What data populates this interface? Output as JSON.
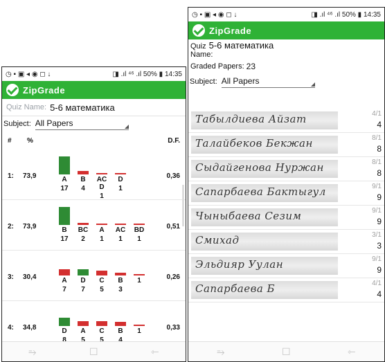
{
  "status_bar": {
    "left_icons": "◷ ▪ ▣ ◂ ◉ ◻ ↓",
    "right_text": "◨ .ıl ⁴⁶ .ıl 50% ▮ 14:35"
  },
  "app": {
    "title": "ZipGrade"
  },
  "left_phone": {
    "quiz_label": "Quiz Name:",
    "quiz_name": "5-6 математика",
    "subject_label": "Subject:",
    "subject_value": "All Papers",
    "headers": {
      "num": "#",
      "pct": "%",
      "df": "D.F."
    },
    "questions": [
      {
        "num": "1:",
        "pct": "73,9",
        "df": "0,36",
        "options": [
          {
            "label": "A",
            "count": "17",
            "color": "#2e8b34",
            "frac": 1.0
          },
          {
            "label": "B",
            "count": "4",
            "color": "#d32f2f",
            "frac": 0.2
          },
          {
            "label": "AC D",
            "count": "1",
            "color": "#d32f2f",
            "frac": 0.03
          },
          {
            "label": "D",
            "count": "1",
            "color": "#d32f2f",
            "frac": 0.03
          }
        ]
      },
      {
        "num": "2:",
        "pct": "73,9",
        "df": "0,51",
        "options": [
          {
            "label": "B",
            "count": "17",
            "color": "#2e8b34",
            "frac": 1.0
          },
          {
            "label": "BC",
            "count": "2",
            "color": "#d32f2f",
            "frac": 0.1
          },
          {
            "label": "A",
            "count": "1",
            "color": "#d32f2f",
            "frac": 0.03
          },
          {
            "label": "AC",
            "count": "1",
            "color": "#d32f2f",
            "frac": 0.03
          },
          {
            "label": "BD",
            "count": "1",
            "color": "#d32f2f",
            "frac": 0.03
          }
        ]
      },
      {
        "num": "3:",
        "pct": "30,4",
        "df": "0,26",
        "options": [
          {
            "label": "A",
            "count": "7",
            "color": "#d32f2f",
            "frac": 0.35
          },
          {
            "label": "D",
            "count": "7",
            "color": "#2e8b34",
            "frac": 0.35
          },
          {
            "label": "C",
            "count": "5",
            "color": "#d32f2f",
            "frac": 0.25
          },
          {
            "label": "B",
            "count": "3",
            "color": "#d32f2f",
            "frac": 0.15
          },
          {
            "label": "",
            "count": "1",
            "color": "#d32f2f",
            "frac": 0.03
          }
        ]
      },
      {
        "num": "4:",
        "pct": "34,8",
        "df": "0,33",
        "options": [
          {
            "label": "D",
            "count": "8",
            "color": "#2e8b34",
            "frac": 0.45
          },
          {
            "label": "A",
            "count": "5",
            "color": "#d32f2f",
            "frac": 0.28
          },
          {
            "label": "C",
            "count": "5",
            "color": "#d32f2f",
            "frac": 0.28
          },
          {
            "label": "B",
            "count": "4",
            "color": "#d32f2f",
            "frac": 0.22
          },
          {
            "label": "",
            "count": "1",
            "color": "#d32f2f",
            "frac": 0.03
          }
        ]
      }
    ]
  },
  "right_phone": {
    "quiz_label": "Quiz",
    "quiz_name": "5-6 математика",
    "name_label": "Name:",
    "graded_label": "Graded Papers:",
    "graded_count": "23",
    "subject_label": "Subject:",
    "subject_value": "All Papers",
    "papers": [
      {
        "signature": "Табылдиева Айзат",
        "fraction": "4/1",
        "score": "4"
      },
      {
        "signature": "Талайбеков Бекжан",
        "fraction": "8/1",
        "score": "8"
      },
      {
        "signature": "Сыдайгенова Нуржан",
        "fraction": "8/1",
        "score": "8"
      },
      {
        "signature": "Сапарбаева Бактыгул",
        "fraction": "9/1",
        "score": "9"
      },
      {
        "signature": "Чыныбаева Сезим",
        "fraction": "9/1",
        "score": "9"
      },
      {
        "signature": "Смихад",
        "fraction": "3/1",
        "score": "3"
      },
      {
        "signature": "Эльдияр Уулан",
        "fraction": "9/1",
        "score": "9"
      },
      {
        "signature": "Сапарбаева Б",
        "fraction": "4/1",
        "score": "4"
      }
    ]
  },
  "nav": {
    "back": "⇽",
    "home": "☐",
    "recent": "⥱"
  },
  "colors": {
    "brand_green": "#2fb236",
    "correct": "#2e8b34",
    "incorrect": "#d32f2f"
  }
}
